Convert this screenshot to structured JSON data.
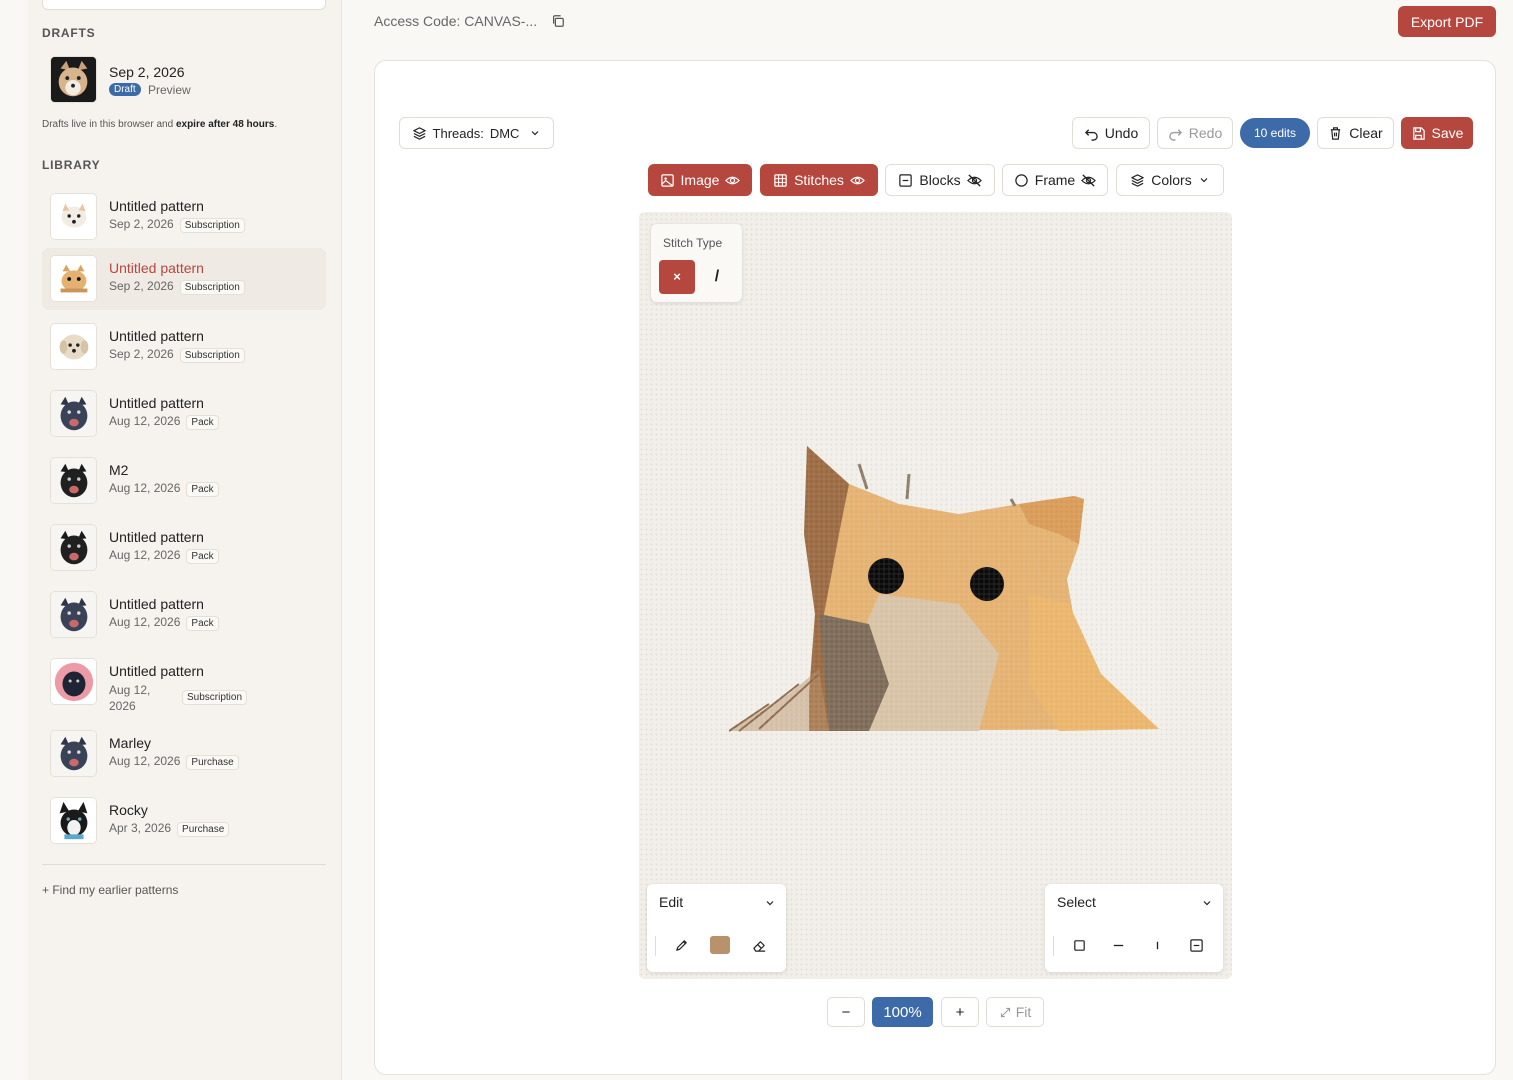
{
  "sidebar": {
    "drafts_heading": "DRAFTS",
    "draft": {
      "date": "Sep 2, 2026",
      "badge": "Draft",
      "preview": "Preview"
    },
    "note_prefix": "Drafts live in this browser and",
    "note_bold": "expire after 48 hours",
    "note_suffix": ".",
    "library_heading": "LIBRARY",
    "library": [
      {
        "title": "Untitled pattern",
        "date": "Sep 2, 2026",
        "tag": "Subscription",
        "thumb": "white-dog"
      },
      {
        "title": "Untitled pattern",
        "date": "Sep 2, 2026",
        "tag": "Subscription",
        "thumb": "orange-cat",
        "active": true
      },
      {
        "title": "Untitled pattern",
        "date": "Sep 2, 2026",
        "tag": "Subscription",
        "thumb": "cream-dog"
      },
      {
        "title": "Untitled pattern",
        "date": "Aug 12, 2026",
        "tag": "Pack",
        "thumb": "dark-dog"
      },
      {
        "title": "M2",
        "date": "Aug 12, 2026",
        "tag": "Pack",
        "thumb": "black-dog"
      },
      {
        "title": "Untitled pattern",
        "date": "Aug 12, 2026",
        "tag": "Pack",
        "thumb": "black-dog"
      },
      {
        "title": "Untitled pattern",
        "date": "Aug 12, 2026",
        "tag": "Pack",
        "thumb": "dark-dog"
      },
      {
        "title": "Untitled pattern",
        "date": "Aug 12, 2026",
        "tag": "Subscription",
        "thumb": "pink-dog"
      },
      {
        "title": "Marley",
        "date": "Aug 12, 2026",
        "tag": "Purchase",
        "thumb": "dark-dog"
      },
      {
        "title": "Rocky",
        "date": "Apr 3, 2026",
        "tag": "Purchase",
        "thumb": "husky"
      }
    ],
    "find_link": "+ Find my earlier patterns"
  },
  "topbar": {
    "access_code": "Access Code: CANVAS-...",
    "export_label": "Export PDF"
  },
  "toolbar": {
    "threads_label": "Threads:",
    "threads_value": "DMC",
    "undo": "Undo",
    "redo": "Redo",
    "edits": "10 edits",
    "clear": "Clear",
    "save": "Save"
  },
  "layers": {
    "image": "Image",
    "stitches": "Stitches",
    "blocks": "Blocks",
    "frame": "Frame",
    "colors": "Colors"
  },
  "stitch_panel": {
    "label": "Stitch Type",
    "cross": "×",
    "half": "/"
  },
  "edit_panel": {
    "label": "Edit",
    "swatch_color": "#b8926a"
  },
  "select_panel": {
    "label": "Select"
  },
  "zoom": {
    "minus": "−",
    "level": "100%",
    "plus": "+",
    "fit": "Fit"
  },
  "colors": {
    "accent": "#b5473e",
    "blue": "#3d6aa8"
  }
}
